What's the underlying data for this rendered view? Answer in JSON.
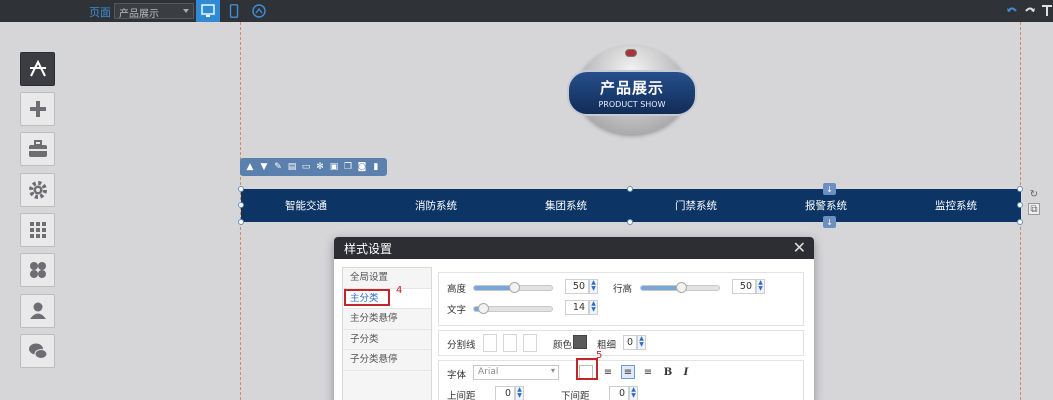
{
  "topbar": {
    "page_label": "页面",
    "page_select": "产品展示",
    "devices": [
      "desktop-icon",
      "mobile-icon",
      "wechat-icon"
    ],
    "right_icons": [
      "undo-icon",
      "redo-icon",
      "pin-icon"
    ]
  },
  "sidebar": {
    "items": [
      {
        "name": "design-icon",
        "active": true
      },
      {
        "name": "add-icon"
      },
      {
        "name": "toolbox-icon"
      },
      {
        "name": "settings-icon"
      },
      {
        "name": "grid-apps-icon"
      },
      {
        "name": "modules-icon"
      },
      {
        "name": "user-icon"
      },
      {
        "name": "chat-icon"
      }
    ]
  },
  "logo": {
    "title": "产品展示",
    "subtitle": "PRODUCT SHOW"
  },
  "nav": {
    "items": [
      "智能交通",
      "消防系统",
      "集团系统",
      "门禁系统",
      "报警系统",
      "监控系统"
    ],
    "background": "#0c3566"
  },
  "dialog": {
    "title": "样式设置",
    "menu": [
      "全局设置",
      "主分类",
      "主分类悬停",
      "子分类",
      "子分类悬停"
    ],
    "active_menu": "主分类",
    "annotations": {
      "menu_marker": "4",
      "color_marker": "5"
    },
    "height_label": "高度",
    "height_value": "50",
    "line_height_label": "行高",
    "line_height_value": "50",
    "text_label": "文字",
    "text_value": "14",
    "divider_label": "分割线",
    "color_label": "颜色",
    "thickness_label": "粗细",
    "thickness_value": "0",
    "font_label": "字体",
    "font_value": "Arial",
    "bold_label": "B",
    "italic_label": "I",
    "margin_top_label": "上间距",
    "margin_top_value": "0",
    "margin_bottom_label": "下间距",
    "margin_bottom_value": "0"
  }
}
